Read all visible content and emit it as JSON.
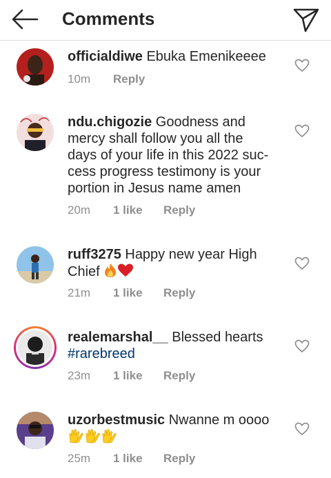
{
  "header": {
    "title": "Comments",
    "back_icon": "arrow-left-icon",
    "share_icon": "send-icon"
  },
  "comments": [
    {
      "username": "officialdiwe",
      "text": " Ebuka Emenikeeee",
      "time": "10m",
      "likes": "",
      "reply": "Reply"
    },
    {
      "username": "ndu.chigozie",
      "text": " Goodness and mercy shall follow you all the days of your life in this 2022 suc-cess progress testimony is your portion in Jesus name amen",
      "time": "20m",
      "likes": "1 like",
      "reply": "Reply"
    },
    {
      "username": "ruff3275",
      "text": " Happy new year High Chief",
      "time": "21m",
      "likes": "1 like",
      "reply": "Reply"
    },
    {
      "username": "realemarshal__",
      "text": " Blessed hearts",
      "hashtag": "#rarebreed",
      "time": "23m",
      "likes": "1 like",
      "reply": "Reply"
    },
    {
      "username": "uzorbestmusic",
      "text": " Nwanne m oooo",
      "time": "25m",
      "likes": "1 like",
      "reply": "Reply"
    }
  ],
  "colors": {
    "text": "#262626",
    "meta": "#8e8e8e",
    "hashtag": "#00376b",
    "fire": "#f5821f",
    "heart": "#d81f26",
    "clap": "#ffcc22"
  }
}
